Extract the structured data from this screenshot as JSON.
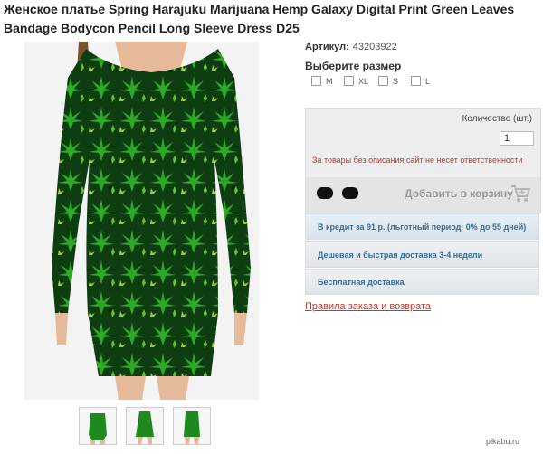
{
  "product": {
    "title": "Женское платье Spring Harajuku Marijuana Hemp Galaxy Digital Print Green Leaves Bandage Bodycon Pencil Long Sleeve Dress D25",
    "sku_label": "Артикул:",
    "sku_value": "43203922"
  },
  "size_selector": {
    "title": "Выберите размер",
    "options": [
      "M",
      "XL",
      "S",
      "L"
    ]
  },
  "order_panel": {
    "quantity_label": "Количество (шт.)",
    "quantity_value": "1",
    "warning": "За товары без описания сайт не несет ответственности",
    "add_to_cart": "Добавить в корзину"
  },
  "info_rows": [
    "В кредит за 91 р. (льготный период: 0% до 55 дней)",
    "Дешевая и быстрая доставка 3-4 недели",
    "Бесплатная доставка"
  ],
  "rules_link": "Правила заказа и возврата",
  "watermark": "pikabu.ru",
  "colors": {
    "dress_green": "#1e8a1e",
    "leaf_light": "#8fd12a",
    "warning_red": "#c0392b",
    "info_blue": "#3d6b8f"
  }
}
